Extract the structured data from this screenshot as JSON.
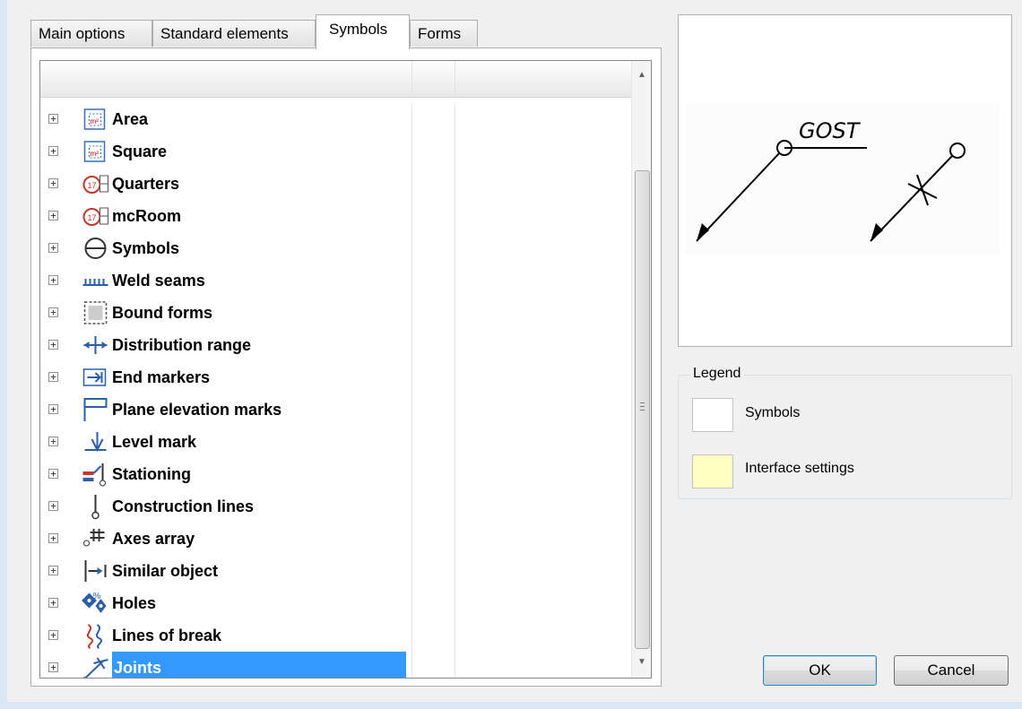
{
  "tabs": [
    {
      "label": "Main options",
      "active": false
    },
    {
      "label": "Standard elements",
      "active": false
    },
    {
      "label": "Symbols",
      "active": true
    },
    {
      "label": "Forms",
      "active": false
    }
  ],
  "tree": {
    "expander_glyph": "+",
    "items": [
      {
        "label": "Area",
        "icon": "area-icon"
      },
      {
        "label": "Square",
        "icon": "square-icon"
      },
      {
        "label": "Quarters",
        "icon": "quarters-icon"
      },
      {
        "label": "mcRoom",
        "icon": "mcroom-icon"
      },
      {
        "label": "Symbols",
        "icon": "symbols-icon"
      },
      {
        "label": "Weld seams",
        "icon": "weld-seams-icon"
      },
      {
        "label": "Bound forms",
        "icon": "bound-forms-icon"
      },
      {
        "label": "Distribution range",
        "icon": "distribution-range-icon"
      },
      {
        "label": "End markers",
        "icon": "end-markers-icon"
      },
      {
        "label": "Plane elevation marks",
        "icon": "plane-elevation-icon"
      },
      {
        "label": "Level mark",
        "icon": "level-mark-icon"
      },
      {
        "label": "Stationing",
        "icon": "stationing-icon"
      },
      {
        "label": "Construction lines",
        "icon": "construction-lines-icon"
      },
      {
        "label": "Axes array",
        "icon": "axes-array-icon"
      },
      {
        "label": "Similar object",
        "icon": "similar-object-icon"
      },
      {
        "label": "Holes",
        "icon": "holes-icon"
      },
      {
        "label": "Lines of break",
        "icon": "lines-of-break-icon"
      },
      {
        "label": "Joints",
        "icon": "joints-icon",
        "selected": true
      }
    ]
  },
  "preview": {
    "text": "GOST"
  },
  "legend": {
    "title": "Legend",
    "items": [
      {
        "label": "Symbols",
        "color": "#ffffff"
      },
      {
        "label": "Interface settings",
        "color": "#ffffc0"
      }
    ]
  },
  "buttons": {
    "ok": "OK",
    "cancel": "Cancel"
  },
  "colors": {
    "selection": "#3399ff",
    "window_bg": "#f0f0f0"
  }
}
